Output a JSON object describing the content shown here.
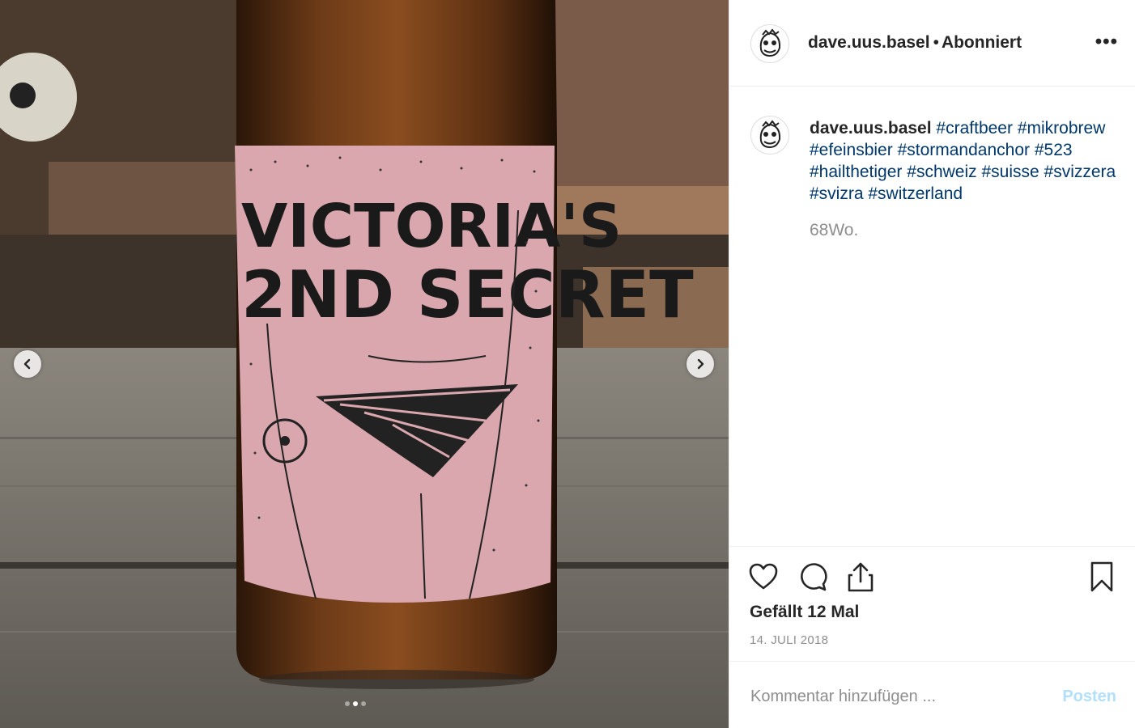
{
  "photo": {
    "label_line1": "VICTORIA'S",
    "label_line2": "2ND SECRET",
    "carousel": {
      "total": 3,
      "active": 2
    }
  },
  "header": {
    "username": "dave.uus.basel",
    "separator": "•",
    "follow_status": "Abonniert",
    "more_label": "•••"
  },
  "caption": {
    "username": "dave.uus.basel",
    "hashtags": [
      "#craftbeer",
      "#mikrobrew",
      "#efeinsbier",
      "#stormandanchor",
      "#523",
      "#hailthetiger",
      "#schweiz",
      "#suisse",
      "#svizzera",
      "#svizra",
      "#switzerland"
    ],
    "time": "68Wo."
  },
  "actions": {
    "likes": "Gefällt 12 Mal",
    "date": "14. JULI 2018"
  },
  "comment": {
    "placeholder": "Kommentar hinzufügen ...",
    "post_label": "Posten"
  },
  "icons": [
    "heart-icon",
    "comment-icon",
    "share-icon",
    "bookmark-icon",
    "chevron-left-icon",
    "chevron-right-icon",
    "more-icon"
  ]
}
